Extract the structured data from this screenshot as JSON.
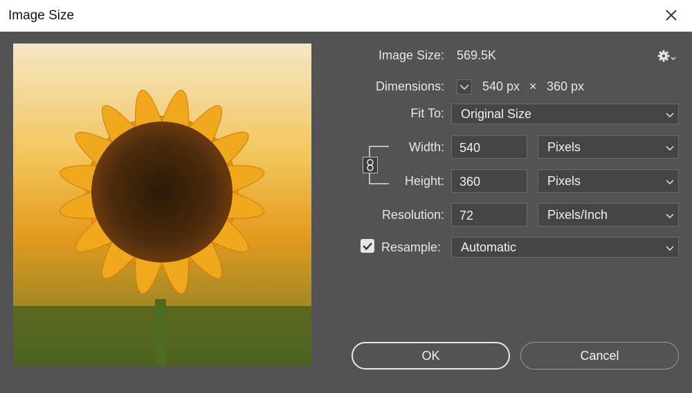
{
  "window": {
    "title": "Image Size"
  },
  "colors": {
    "background": "#535353",
    "field": "#454545",
    "text": "#e6e6e6"
  },
  "icons": {
    "close": "close-icon",
    "settings": "gear-icon",
    "link": "chain-link-icon",
    "dropdown": "chevron-down-icon",
    "check": "checkmark-icon"
  },
  "info": {
    "image_size_label": "Image Size:",
    "image_size_value": "569.5K",
    "dimensions_label": "Dimensions:",
    "dim_width": "540 px",
    "dim_sep": "×",
    "dim_height": "360 px"
  },
  "fit_to": {
    "label": "Fit To:",
    "value": "Original Size"
  },
  "width": {
    "label": "Width:",
    "value": "540",
    "unit": "Pixels"
  },
  "height": {
    "label": "Height:",
    "value": "360",
    "unit": "Pixels"
  },
  "resolution": {
    "label": "Resolution:",
    "value": "72",
    "unit": "Pixels/Inch"
  },
  "resample": {
    "label": "Resample:",
    "checked": true,
    "value": "Automatic"
  },
  "buttons": {
    "ok": "OK",
    "cancel": "Cancel"
  }
}
